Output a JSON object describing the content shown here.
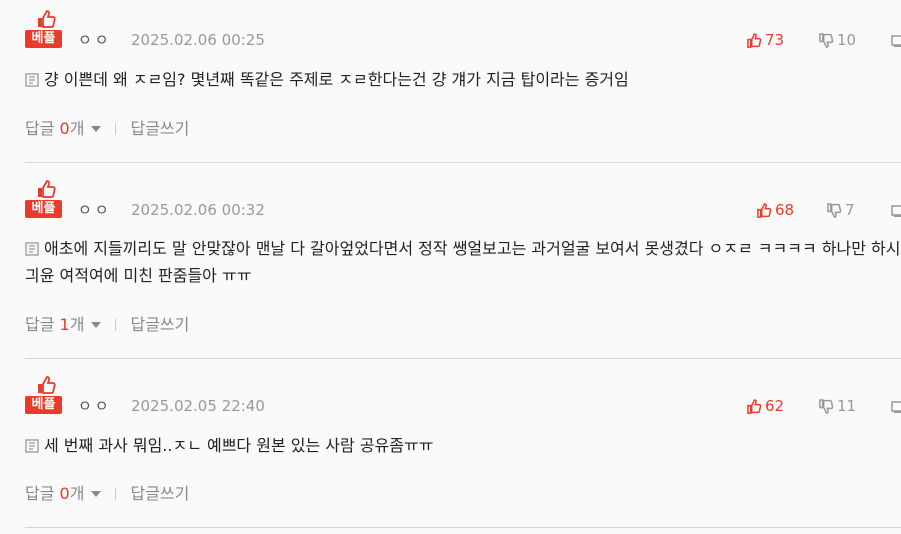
{
  "comments": [
    {
      "badge": "베플",
      "author": "ㅇㅇ",
      "date": "2025.02.06 00:25",
      "up": "73",
      "down": "10",
      "text": "걍 이쁜데 왜 ㅈㄹ임? 몇년째 똑같은 주제로 ㅈㄹ한다는건 걍 걔가 지금 탑이라는 증거임",
      "reply_label": "답글",
      "reply_count": "0",
      "reply_unit": "개",
      "write_reply": "답글쓰기"
    },
    {
      "badge": "베플",
      "author": "ㅇㅇ",
      "date": "2025.02.06 00:32",
      "up": "68",
      "down": "7",
      "text": "애초에 지들끼리도 말 안맞잖아 맨날 다 갈아엎었다면서 정작 쌩얼보고는 과거얼굴 보여서 못생겼다 ㅇㅈㄹ ㅋㅋㅋㅋ 하나만 하시긔윤 여적여에 미친 판줌들아 ㅠㅠ",
      "reply_label": "답글",
      "reply_count": "1",
      "reply_unit": "개",
      "write_reply": "답글쓰기"
    },
    {
      "badge": "베플",
      "author": "ㅇㅇ",
      "date": "2025.02.05 22:40",
      "up": "62",
      "down": "11",
      "text": "세 번째 과사 뭐임..ㅈㄴ 예쁘다 원본 있는 사람 공유좀ㅠㅠ",
      "reply_label": "답글",
      "reply_count": "0",
      "reply_unit": "개",
      "write_reply": "답글쓰기"
    }
  ],
  "colors": {
    "accent": "#e83b2b",
    "muted": "#999999"
  }
}
